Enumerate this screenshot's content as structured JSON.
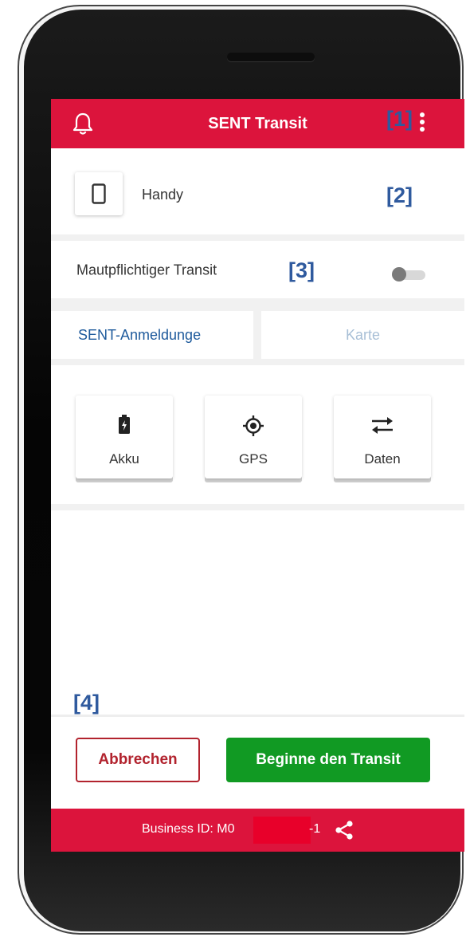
{
  "app": {
    "title": "SENT Transit"
  },
  "markers": {
    "m1": "[1]",
    "m2": "[2]",
    "m3": "[3]",
    "m4": "[4]"
  },
  "device": {
    "label": "Handy",
    "icon": "phone-icon"
  },
  "toll": {
    "label": "Mautpflichtiger Transit",
    "enabled": false
  },
  "tabs": [
    {
      "label": "SENT-Anmeldunge",
      "active": true
    },
    {
      "label": "Karte",
      "active": false
    }
  ],
  "status": [
    {
      "label": "Akku",
      "icon": "battery-icon"
    },
    {
      "label": "GPS",
      "icon": "gps-icon"
    },
    {
      "label": "Daten",
      "icon": "data-transfer-icon"
    }
  ],
  "actions": {
    "cancel": "Abbrechen",
    "start": "Beginne den Transit"
  },
  "footer": {
    "business_label": "Business ID:  M0",
    "business_suffix": "-1"
  },
  "colors": {
    "brand": "#dc143c",
    "primary_green": "#119a23",
    "link_blue": "#1e5a9c",
    "marker_blue": "#2f5a9e"
  }
}
